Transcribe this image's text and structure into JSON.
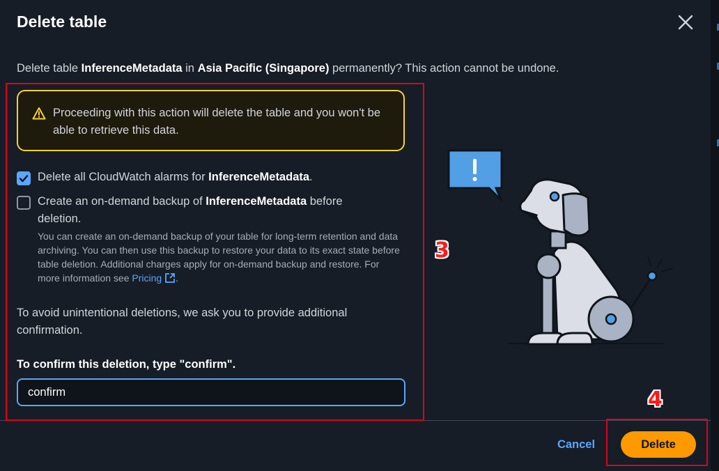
{
  "dialog": {
    "title": "Delete table",
    "description": {
      "prefix": "Delete table ",
      "table_name": "InferenceMetadata",
      "middle": " in ",
      "region": "Asia Pacific (Singapore)",
      "suffix": " permanently? This action cannot be undone."
    },
    "warning": {
      "icon": "warning-triangle-icon",
      "text": "Proceeding with this action will delete the table and you won't be able to retrieve this data."
    },
    "options": {
      "delete_alarms": {
        "checked": true,
        "prefix": "Delete all CloudWatch alarms for ",
        "table_name": "InferenceMetadata",
        "suffix": "."
      },
      "create_backup": {
        "checked": false,
        "prefix": "Create an on-demand backup of ",
        "table_name": "InferenceMetadata",
        "suffix": " before deletion.",
        "help": "You can create an on-demand backup of your table for long-term retention and data archiving. You can then use this backup to restore your data to its exact state before table deletion. Additional charges apply for on-demand backup and restore. For more information see ",
        "link_label": "Pricing",
        "help_end": "."
      }
    },
    "confirmation_note": "To avoid unintentional deletions, we ask you to provide additional confirmation.",
    "confirm_label": "To confirm this deletion, type \"confirm\".",
    "confirm_input_value": "confirm",
    "buttons": {
      "cancel": "Cancel",
      "delete": "Delete"
    }
  },
  "annotations": [
    "3",
    "4"
  ],
  "colors": {
    "accent": "#5ba6ff",
    "primary_button": "#ff9900",
    "warning_border": "#fbd332",
    "annotation": "#e0001a"
  }
}
